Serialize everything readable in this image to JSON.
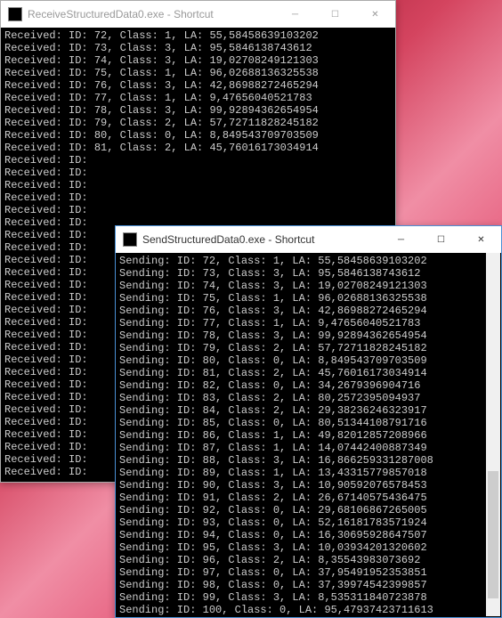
{
  "windows": {
    "receive": {
      "title": "ReceiveStructuredData0.exe - Shortcut",
      "lines": [
        "Received: ID: 72, Class: 1, LA: 55,58458639103202",
        "Received: ID: 73, Class: 3, LA: 95,5846138743612",
        "Received: ID: 74, Class: 3, LA: 19,02708249121303",
        "Received: ID: 75, Class: 1, LA: 96,02688136325538",
        "Received: ID: 76, Class: 3, LA: 42,86988272465294",
        "Received: ID: 77, Class: 1, LA: 9,47656040521783",
        "Received: ID: 78, Class: 3, LA: 99,92894362654954",
        "Received: ID: 79, Class: 2, LA: 57,72711828245182",
        "Received: ID: 80, Class: 0, LA: 8,849543709703509",
        "Received: ID: 81, Class: 2, LA: 45,76016173034914",
        "Received: ID:",
        "Received: ID:",
        "Received: ID:",
        "Received: ID:",
        "Received: ID:",
        "Received: ID:",
        "Received: ID:",
        "Received: ID:",
        "Received: ID:",
        "Received: ID:",
        "Received: ID:",
        "Received: ID:",
        "Received: ID:",
        "Received: ID:",
        "Received: ID:",
        "Received: ID:",
        "Received: ID:",
        "Received: ID:",
        "Received: ID:",
        "Received: ID:",
        "Received: ID:",
        "Received: ID:",
        "Received: ID:",
        "Received: ID:",
        "Received: ID:",
        "Received: ID:"
      ]
    },
    "send": {
      "title": "SendStructuredData0.exe - Shortcut",
      "lines": [
        "Sending: ID: 72, Class: 1, LA: 55,58458639103202",
        "Sending: ID: 73, Class: 3, LA: 95,5846138743612",
        "Sending: ID: 74, Class: 3, LA: 19,02708249121303",
        "Sending: ID: 75, Class: 1, LA: 96,02688136325538",
        "Sending: ID: 76, Class: 3, LA: 42,86988272465294",
        "Sending: ID: 77, Class: 1, LA: 9,47656040521783",
        "Sending: ID: 78, Class: 3, LA: 99,92894362654954",
        "Sending: ID: 79, Class: 2, LA: 57,72711828245182",
        "Sending: ID: 80, Class: 0, LA: 8,849543709703509",
        "Sending: ID: 81, Class: 2, LA: 45,76016173034914",
        "Sending: ID: 82, Class: 0, LA: 34,2679396904716",
        "Sending: ID: 83, Class: 2, LA: 80,2572395094937",
        "Sending: ID: 84, Class: 2, LA: 29,38236246323917",
        "Sending: ID: 85, Class: 0, LA: 80,51344108791716",
        "Sending: ID: 86, Class: 1, LA: 49,82012857208966",
        "Sending: ID: 87, Class: 1, LA: 14,07442400887349",
        "Sending: ID: 88, Class: 3, LA: 16,866259331287008",
        "Sending: ID: 89, Class: 1, LA: 13,43315779857018",
        "Sending: ID: 90, Class: 3, LA: 10,90592076578453",
        "Sending: ID: 91, Class: 2, LA: 26,67140575436475",
        "Sending: ID: 92, Class: 0, LA: 29,68106867265005",
        "Sending: ID: 93, Class: 0, LA: 52,16181783571924",
        "Sending: ID: 94, Class: 0, LA: 16,30695928647507",
        "Sending: ID: 95, Class: 3, LA: 10,03934201320602",
        "Sending: ID: 96, Class: 2, LA: 8,35543983073692",
        "Sending: ID: 97, Class: 0, LA: 37,95491952353851",
        "Sending: ID: 98, Class: 0, LA: 37,39974542399857",
        "Sending: ID: 99, Class: 3, LA: 8,535311840723878",
        "Sending: ID: 100, Class: 0, LA: 95,47937423711613"
      ]
    }
  },
  "buttons": {
    "minimize": "─",
    "maximize": "☐",
    "close": "✕"
  }
}
